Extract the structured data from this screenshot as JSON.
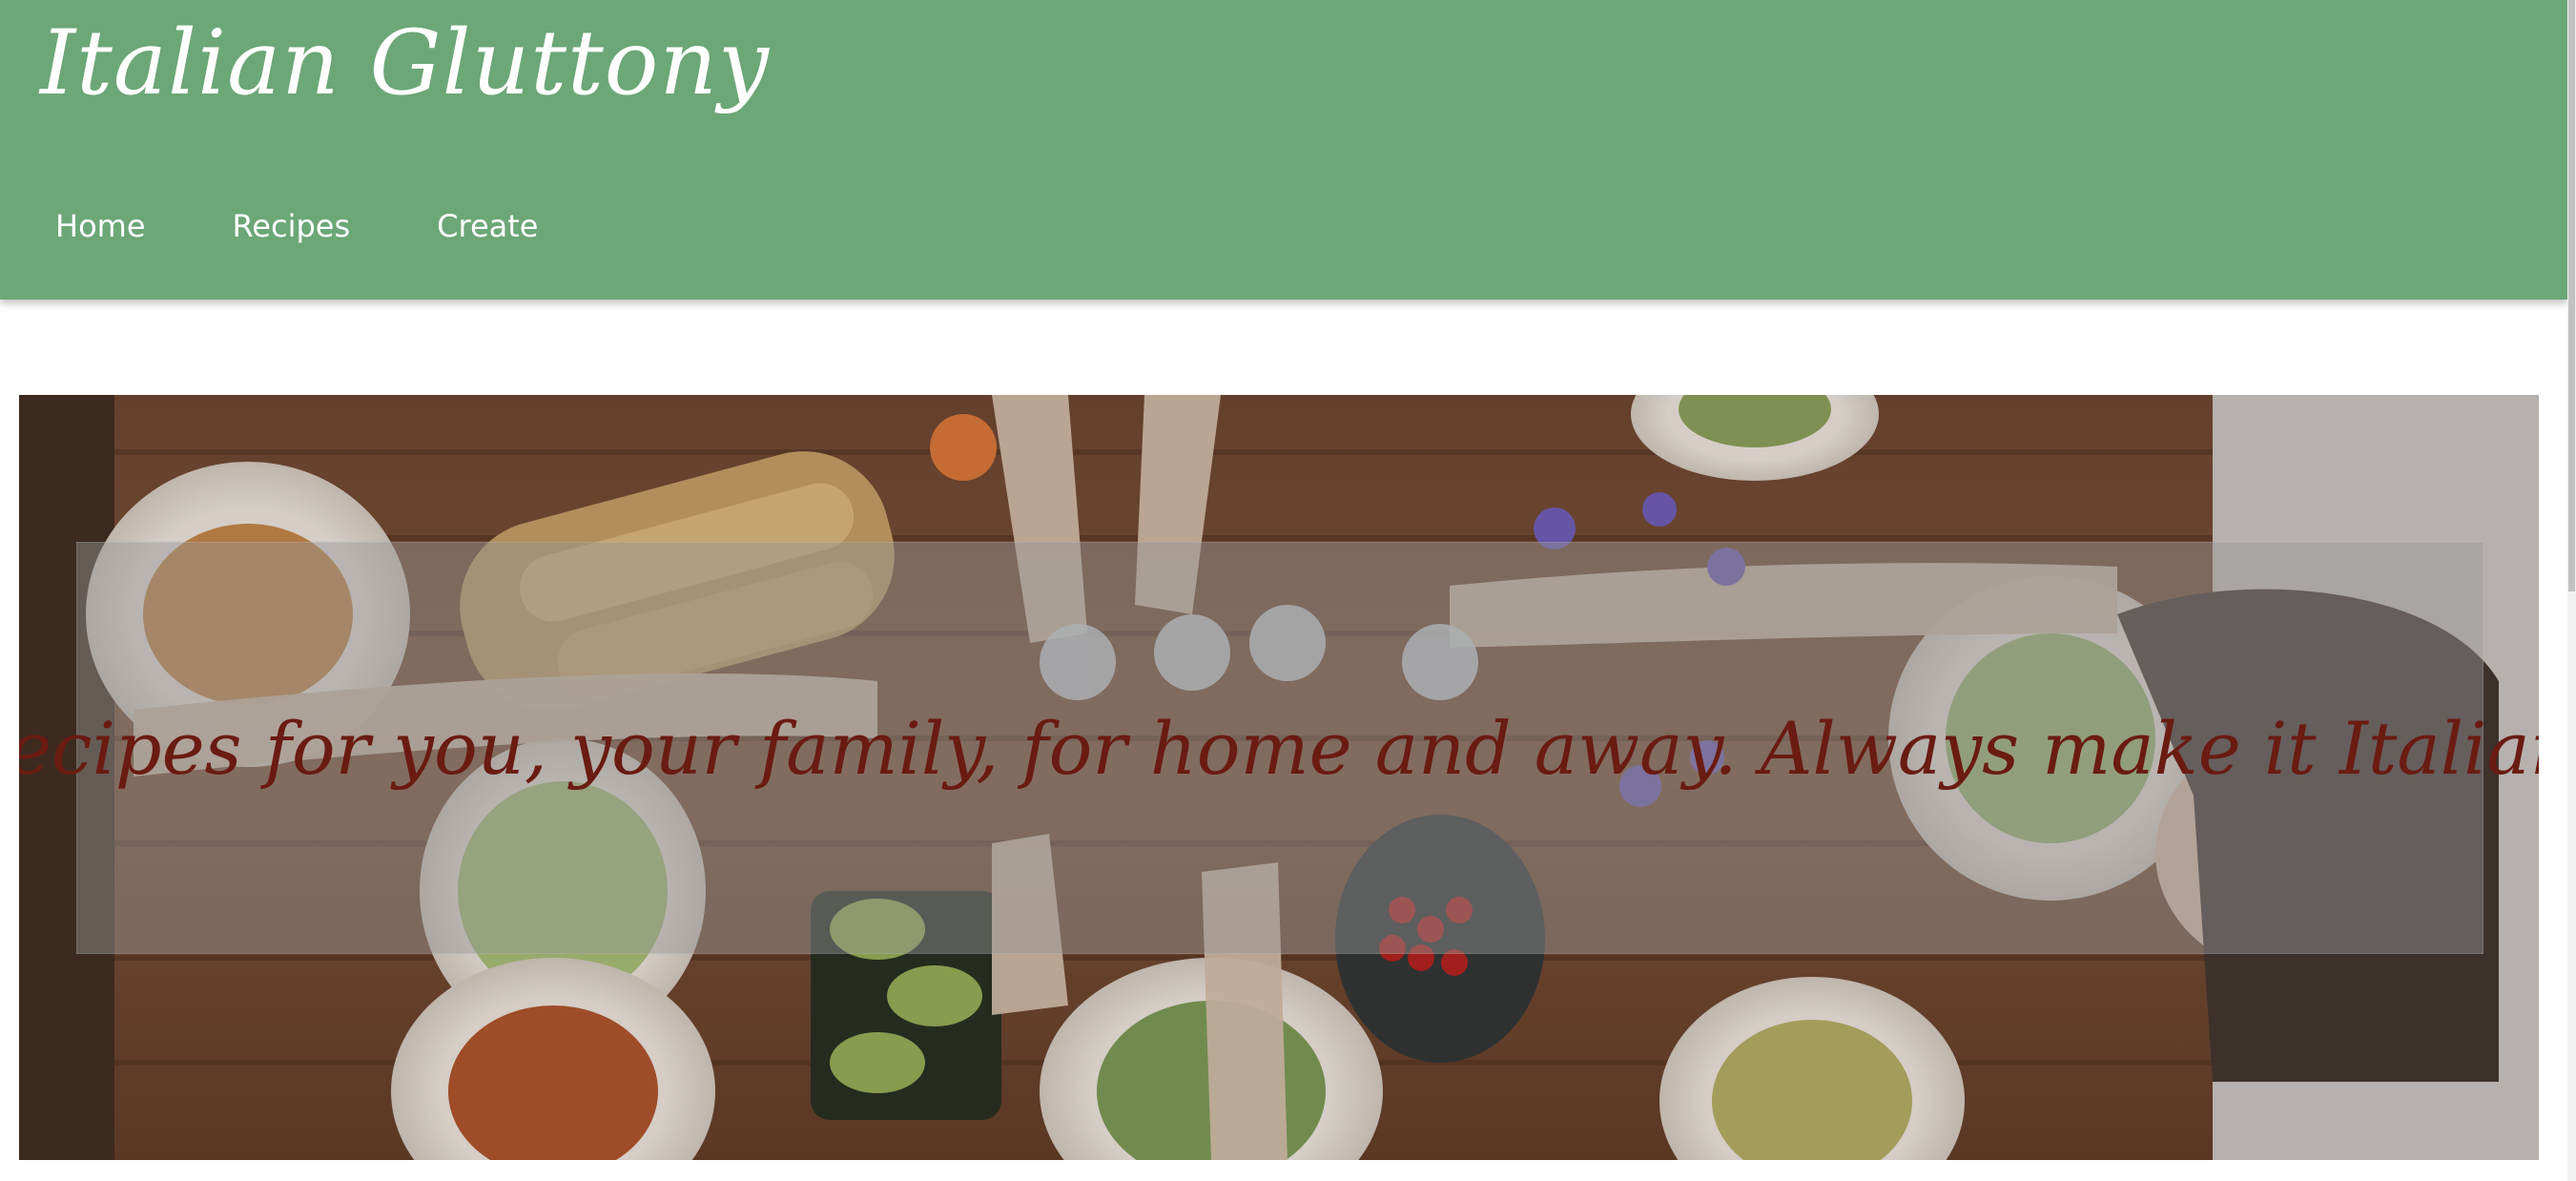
{
  "header": {
    "brand": "Italian Gluttony",
    "background_color": "#6ca777"
  },
  "nav": {
    "items": [
      {
        "label": "Home"
      },
      {
        "label": "Recipes"
      },
      {
        "label": "Create"
      }
    ]
  },
  "hero": {
    "tagline": "Recipes for you, your family, for home and away. Always make it Italian!",
    "tagline_color": "#6a1b12",
    "image_subject": "overhead photo of a dinner table with pasta plates, salads and hands toasting glasses"
  }
}
